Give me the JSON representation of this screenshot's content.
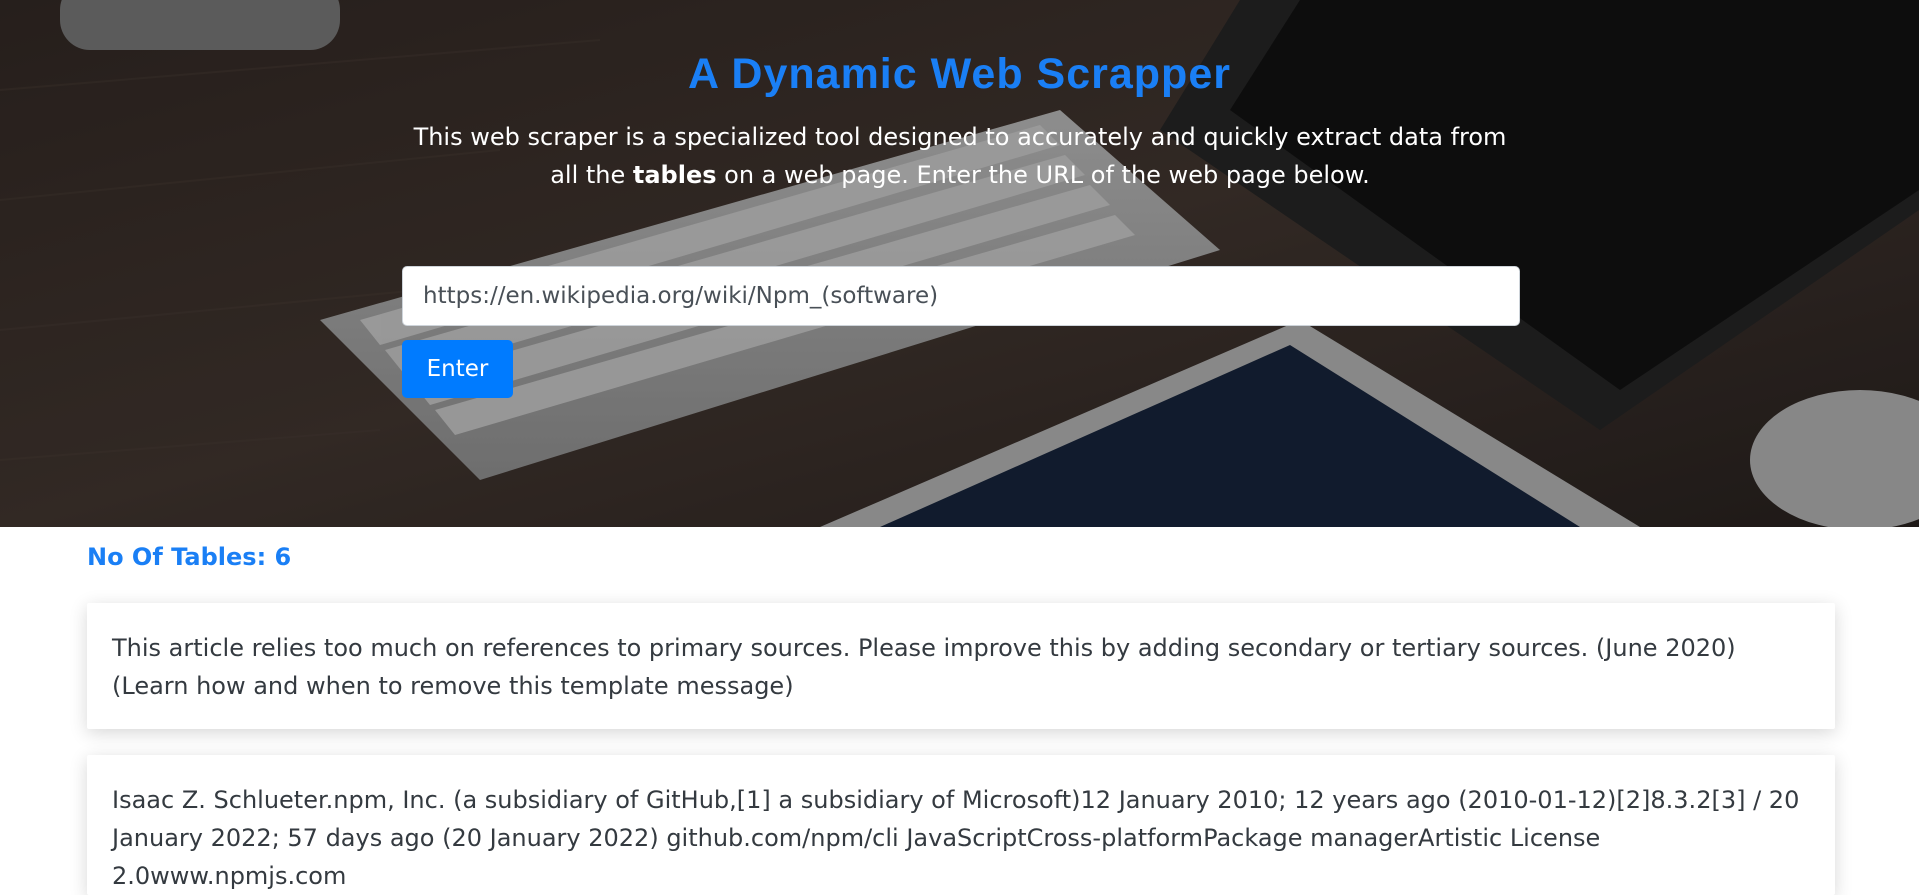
{
  "hero": {
    "title": "A Dynamic Web Scrapper",
    "description_part1": "This web scraper is a specialized tool designed to accurately and quickly extract data from all the ",
    "description_bold": "tables",
    "description_part2": " on a web page. Enter the URL of the web page below."
  },
  "form": {
    "url_value": "https://en.wikipedia.org/wiki/Npm_(software)",
    "enter_label": "Enter"
  },
  "results": {
    "count_label": "No Of Tables: ",
    "count_value": "6",
    "tables": [
      {
        "text": "This article relies too much on references to primary sources. Please improve this by adding secondary or tertiary sources. (June 2020) (Learn how and when to remove this template message)"
      },
      {
        "text": "Isaac Z. Schlueter.npm, Inc. (a subsidiary of GitHub,[1] a subsidiary of Microsoft)12 January 2010; 12 years ago (2010-01-12)[2]8.3.2[3] / 20 January 2022; 57 days ago (20 January 2022) github.com/npm/cli JavaScriptCross-platformPackage managerArtistic License 2.0www.npmjs.com"
      }
    ]
  },
  "colors": {
    "accent": "#1a7ff5",
    "button": "#007bff"
  }
}
